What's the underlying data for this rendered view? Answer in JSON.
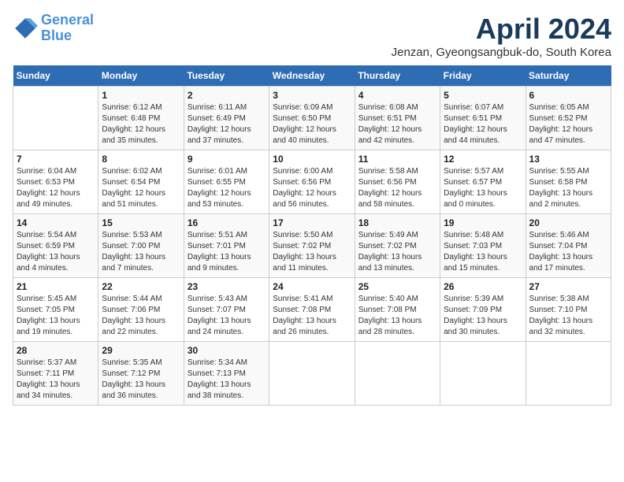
{
  "logo": {
    "line1": "General",
    "line2": "Blue"
  },
  "title": "April 2024",
  "subtitle": "Jenzan, Gyeongsangbuk-do, South Korea",
  "headers": [
    "Sunday",
    "Monday",
    "Tuesday",
    "Wednesday",
    "Thursday",
    "Friday",
    "Saturday"
  ],
  "weeks": [
    [
      {
        "num": "",
        "sunrise": "",
        "sunset": "",
        "daylight": ""
      },
      {
        "num": "1",
        "sunrise": "Sunrise: 6:12 AM",
        "sunset": "Sunset: 6:48 PM",
        "daylight": "Daylight: 12 hours and 35 minutes."
      },
      {
        "num": "2",
        "sunrise": "Sunrise: 6:11 AM",
        "sunset": "Sunset: 6:49 PM",
        "daylight": "Daylight: 12 hours and 37 minutes."
      },
      {
        "num": "3",
        "sunrise": "Sunrise: 6:09 AM",
        "sunset": "Sunset: 6:50 PM",
        "daylight": "Daylight: 12 hours and 40 minutes."
      },
      {
        "num": "4",
        "sunrise": "Sunrise: 6:08 AM",
        "sunset": "Sunset: 6:51 PM",
        "daylight": "Daylight: 12 hours and 42 minutes."
      },
      {
        "num": "5",
        "sunrise": "Sunrise: 6:07 AM",
        "sunset": "Sunset: 6:51 PM",
        "daylight": "Daylight: 12 hours and 44 minutes."
      },
      {
        "num": "6",
        "sunrise": "Sunrise: 6:05 AM",
        "sunset": "Sunset: 6:52 PM",
        "daylight": "Daylight: 12 hours and 47 minutes."
      }
    ],
    [
      {
        "num": "7",
        "sunrise": "Sunrise: 6:04 AM",
        "sunset": "Sunset: 6:53 PM",
        "daylight": "Daylight: 12 hours and 49 minutes."
      },
      {
        "num": "8",
        "sunrise": "Sunrise: 6:02 AM",
        "sunset": "Sunset: 6:54 PM",
        "daylight": "Daylight: 12 hours and 51 minutes."
      },
      {
        "num": "9",
        "sunrise": "Sunrise: 6:01 AM",
        "sunset": "Sunset: 6:55 PM",
        "daylight": "Daylight: 12 hours and 53 minutes."
      },
      {
        "num": "10",
        "sunrise": "Sunrise: 6:00 AM",
        "sunset": "Sunset: 6:56 PM",
        "daylight": "Daylight: 12 hours and 56 minutes."
      },
      {
        "num": "11",
        "sunrise": "Sunrise: 5:58 AM",
        "sunset": "Sunset: 6:56 PM",
        "daylight": "Daylight: 12 hours and 58 minutes."
      },
      {
        "num": "12",
        "sunrise": "Sunrise: 5:57 AM",
        "sunset": "Sunset: 6:57 PM",
        "daylight": "Daylight: 13 hours and 0 minutes."
      },
      {
        "num": "13",
        "sunrise": "Sunrise: 5:55 AM",
        "sunset": "Sunset: 6:58 PM",
        "daylight": "Daylight: 13 hours and 2 minutes."
      }
    ],
    [
      {
        "num": "14",
        "sunrise": "Sunrise: 5:54 AM",
        "sunset": "Sunset: 6:59 PM",
        "daylight": "Daylight: 13 hours and 4 minutes."
      },
      {
        "num": "15",
        "sunrise": "Sunrise: 5:53 AM",
        "sunset": "Sunset: 7:00 PM",
        "daylight": "Daylight: 13 hours and 7 minutes."
      },
      {
        "num": "16",
        "sunrise": "Sunrise: 5:51 AM",
        "sunset": "Sunset: 7:01 PM",
        "daylight": "Daylight: 13 hours and 9 minutes."
      },
      {
        "num": "17",
        "sunrise": "Sunrise: 5:50 AM",
        "sunset": "Sunset: 7:02 PM",
        "daylight": "Daylight: 13 hours and 11 minutes."
      },
      {
        "num": "18",
        "sunrise": "Sunrise: 5:49 AM",
        "sunset": "Sunset: 7:02 PM",
        "daylight": "Daylight: 13 hours and 13 minutes."
      },
      {
        "num": "19",
        "sunrise": "Sunrise: 5:48 AM",
        "sunset": "Sunset: 7:03 PM",
        "daylight": "Daylight: 13 hours and 15 minutes."
      },
      {
        "num": "20",
        "sunrise": "Sunrise: 5:46 AM",
        "sunset": "Sunset: 7:04 PM",
        "daylight": "Daylight: 13 hours and 17 minutes."
      }
    ],
    [
      {
        "num": "21",
        "sunrise": "Sunrise: 5:45 AM",
        "sunset": "Sunset: 7:05 PM",
        "daylight": "Daylight: 13 hours and 19 minutes."
      },
      {
        "num": "22",
        "sunrise": "Sunrise: 5:44 AM",
        "sunset": "Sunset: 7:06 PM",
        "daylight": "Daylight: 13 hours and 22 minutes."
      },
      {
        "num": "23",
        "sunrise": "Sunrise: 5:43 AM",
        "sunset": "Sunset: 7:07 PM",
        "daylight": "Daylight: 13 hours and 24 minutes."
      },
      {
        "num": "24",
        "sunrise": "Sunrise: 5:41 AM",
        "sunset": "Sunset: 7:08 PM",
        "daylight": "Daylight: 13 hours and 26 minutes."
      },
      {
        "num": "25",
        "sunrise": "Sunrise: 5:40 AM",
        "sunset": "Sunset: 7:08 PM",
        "daylight": "Daylight: 13 hours and 28 minutes."
      },
      {
        "num": "26",
        "sunrise": "Sunrise: 5:39 AM",
        "sunset": "Sunset: 7:09 PM",
        "daylight": "Daylight: 13 hours and 30 minutes."
      },
      {
        "num": "27",
        "sunrise": "Sunrise: 5:38 AM",
        "sunset": "Sunset: 7:10 PM",
        "daylight": "Daylight: 13 hours and 32 minutes."
      }
    ],
    [
      {
        "num": "28",
        "sunrise": "Sunrise: 5:37 AM",
        "sunset": "Sunset: 7:11 PM",
        "daylight": "Daylight: 13 hours and 34 minutes."
      },
      {
        "num": "29",
        "sunrise": "Sunrise: 5:35 AM",
        "sunset": "Sunset: 7:12 PM",
        "daylight": "Daylight: 13 hours and 36 minutes."
      },
      {
        "num": "30",
        "sunrise": "Sunrise: 5:34 AM",
        "sunset": "Sunset: 7:13 PM",
        "daylight": "Daylight: 13 hours and 38 minutes."
      },
      {
        "num": "",
        "sunrise": "",
        "sunset": "",
        "daylight": ""
      },
      {
        "num": "",
        "sunrise": "",
        "sunset": "",
        "daylight": ""
      },
      {
        "num": "",
        "sunrise": "",
        "sunset": "",
        "daylight": ""
      },
      {
        "num": "",
        "sunrise": "",
        "sunset": "",
        "daylight": ""
      }
    ]
  ]
}
